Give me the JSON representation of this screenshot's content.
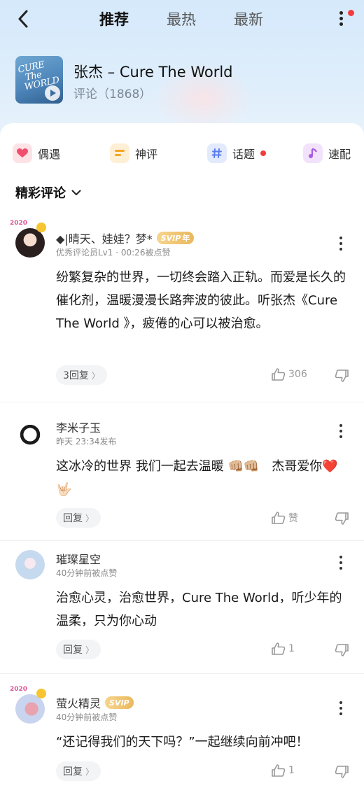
{
  "nav": {
    "tabs": [
      {
        "label": "推荐",
        "active": true
      },
      {
        "label": "最热",
        "active": false
      },
      {
        "label": "最新",
        "active": false
      }
    ]
  },
  "song": {
    "cover_text_1": "CURE",
    "cover_text_2": "The",
    "cover_text_3": "WORLD",
    "title": "张杰 – Cure The World",
    "comment_count": "评论（1868）"
  },
  "chips": [
    {
      "label": "偶遇",
      "icon": "heart-icon",
      "color": "#f0506e"
    },
    {
      "label": "神评",
      "icon": "comment-lines-icon",
      "color": "#f5a623"
    },
    {
      "label": "话题",
      "icon": "hashtag-icon",
      "color": "#5b7cf0",
      "has_dot": true
    },
    {
      "label": "速配",
      "icon": "music-note-icon",
      "color": "#a85ce0"
    }
  ],
  "section": {
    "title": "精彩评论"
  },
  "comments": [
    {
      "name": "◆|晴天、娃娃？梦*",
      "badge": "SVIP",
      "badge_suffix": "年",
      "meta": "优秀评论员Lv1 · 00:26被点赞",
      "frame_text": "2020",
      "text": "纷繁复杂的世界，一切终会踏入正轨。而爱是长久的催化剂，温暖漫漫长路奔波的彼此。听张杰《Cure The World 》，疲倦的心可以被治愈。",
      "reply_label": "3回复",
      "likes": "306"
    },
    {
      "name": "李米子玉",
      "meta": "昨天 23:34发布",
      "text": "这冰冷的世界 我们一起去温暖 👊🏼👊🏼　杰哥爱你❤️🤟🏻",
      "reply_label": "回复",
      "likes": "赞"
    },
    {
      "name": "璀璨星空",
      "meta": "40分钟前被点赞",
      "text": "治愈心灵，治愈世界，Cure The World，听少年的温柔，只为你心动",
      "reply_label": "回复",
      "likes": "1"
    },
    {
      "name": "萤火精灵",
      "badge": "SVIP",
      "meta": "40分钟前被点赞",
      "frame_text": "2020",
      "text": "“还记得我们的天下吗？”一起继续向前冲吧！",
      "reply_label": "回复",
      "likes": "1"
    }
  ]
}
